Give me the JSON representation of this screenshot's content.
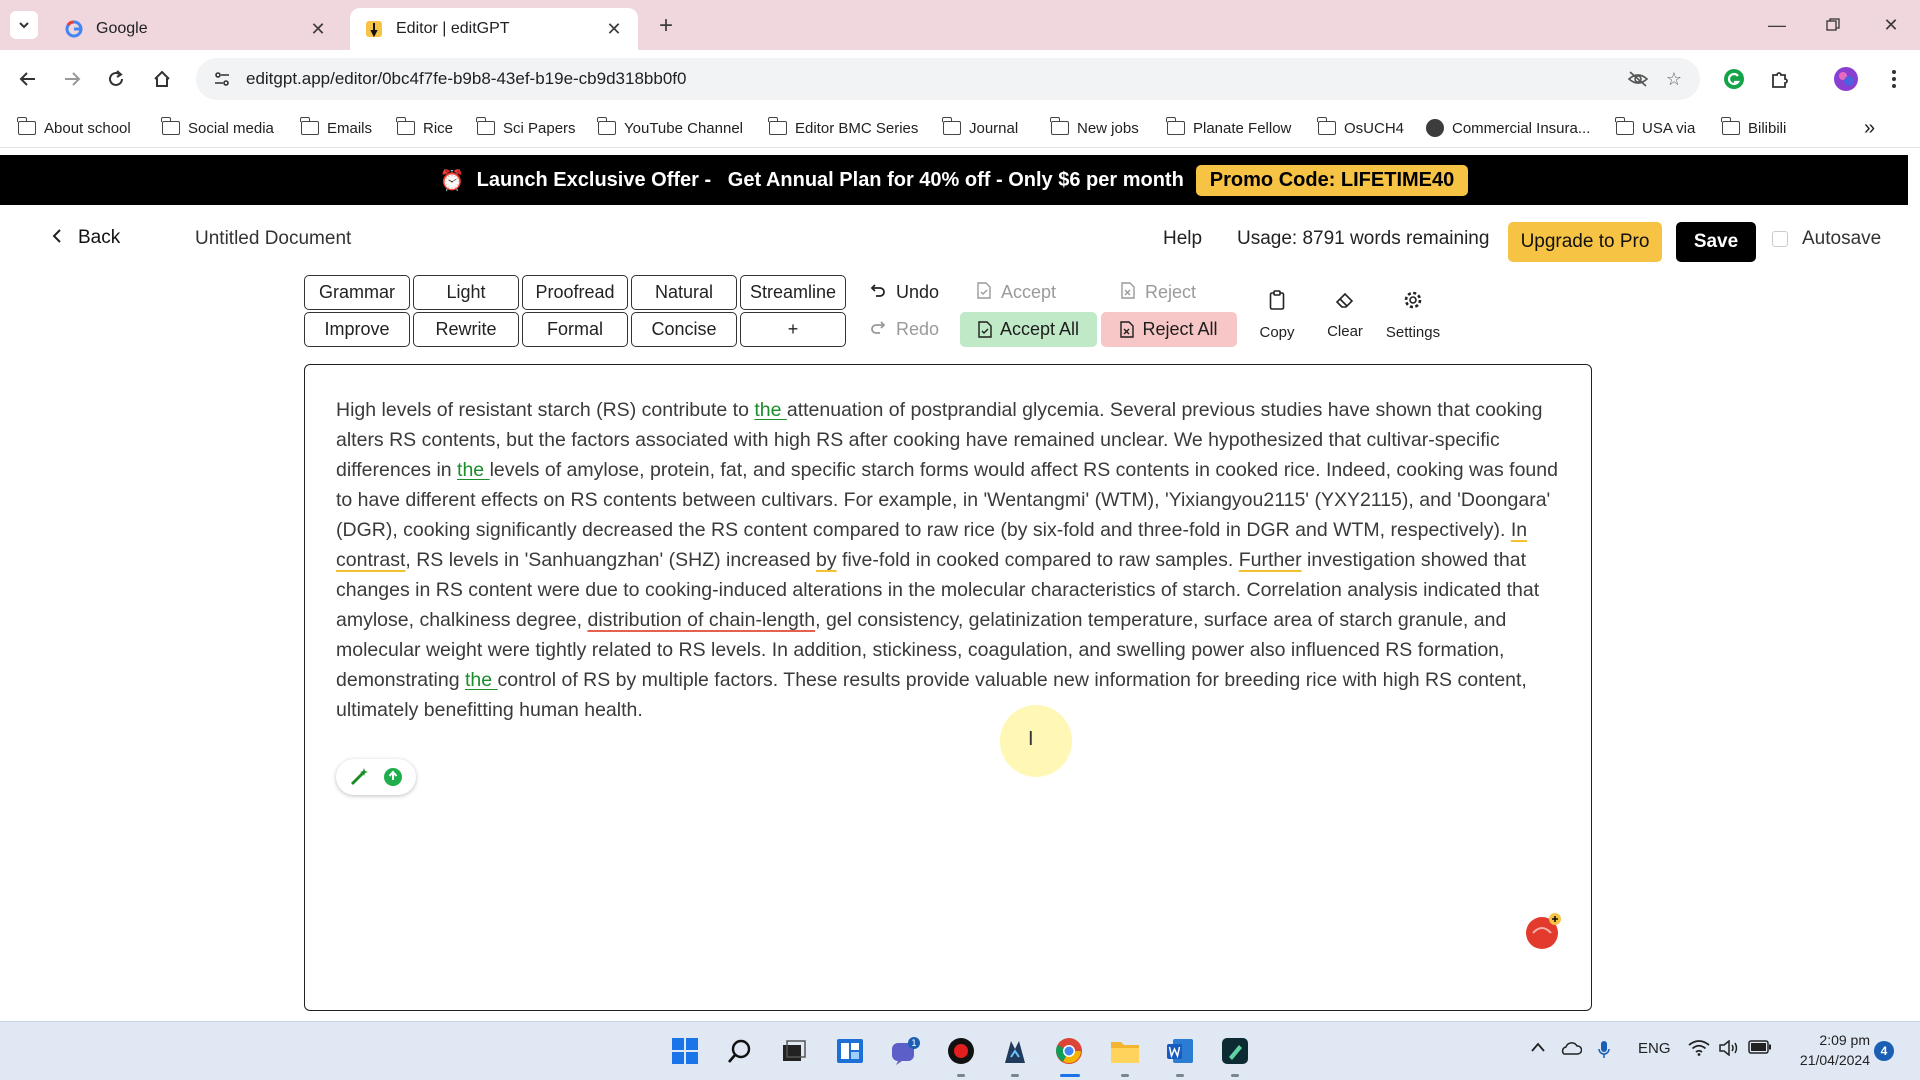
{
  "browser": {
    "tabs": [
      {
        "title": "Google",
        "favicon": "google-icon"
      },
      {
        "title": "Editor | editGPT",
        "favicon": "editgpt-icon"
      }
    ],
    "url": "editgpt.app/editor/0bc4f7fe-b9b8-43ef-b19e-cb9d318bb0f0",
    "bookmarks": [
      "About school",
      "Social media",
      "Emails",
      "Rice",
      "Sci Papers",
      "YouTube Channel",
      "Editor BMC Series",
      "Journal",
      "New jobs",
      "Planate Fellow",
      "OsUCH4",
      "Commercial Insura...",
      "USA via",
      "Bilibili"
    ],
    "more_bookmarks_glyph": "»"
  },
  "promo": {
    "text": "Launch Exclusive Offer -   Get Annual Plan for 40% off - Only $6 per month",
    "code": "Promo Code: LIFETIME40"
  },
  "header": {
    "back": "Back",
    "doc_title": "Untitled Document",
    "help": "Help",
    "usage": "Usage: 8791 words remaining",
    "upgrade": "Upgrade to Pro",
    "save": "Save",
    "autosave": "Autosave"
  },
  "modes": {
    "row1": [
      "Grammar",
      "Light",
      "Proofread",
      "Natural",
      "Streamline"
    ],
    "row2": [
      "Improve",
      "Rewrite",
      "Formal",
      "Concise",
      "+"
    ]
  },
  "actions": {
    "undo": "Undo",
    "redo": "Redo",
    "accept": "Accept",
    "reject": "Reject",
    "accept_all": "Accept All",
    "reject_all": "Reject All",
    "copy": "Copy",
    "clear": "Clear",
    "settings": "Settings"
  },
  "editor": {
    "segments": [
      {
        "text": "High levels of resistant starch (RS) contribute to ",
        "style": "plain"
      },
      {
        "text": "the ",
        "style": "ins"
      },
      {
        "text": "attenuation of postprandial glycemia. Several previous studies have shown that cooking alters RS contents, but the factors associated with high RS after cooking have remained unclear. We hypothesized that cultivar-specific differences in ",
        "style": "plain"
      },
      {
        "text": "the ",
        "style": "ins"
      },
      {
        "text": "levels of amylose, protein, fat, and specific starch forms would affect RS contents in cooked rice. Indeed, cooking was found to have different effects on RS contents between cultivars. For example, in 'Wentangmi' (WTM), 'Yixiangyou2115' (YXY2115), and 'Doongara' (DGR), cooking significantly decreased the RS content compared to raw rice (by six-fold and three-fold in DGR and WTM, respectively). ",
        "style": "plain"
      },
      {
        "text": "In contrast",
        "style": "sug"
      },
      {
        "text": ", RS levels in 'Sanhuangzhan' (SHZ) increased ",
        "style": "plain"
      },
      {
        "text": "by",
        "style": "sug"
      },
      {
        "text": " five-fold in cooked compared to raw samples. ",
        "style": "plain"
      },
      {
        "text": "Further",
        "style": "sug"
      },
      {
        "text": " investigation showed that changes in RS content were due to cooking-induced alterations in the molecular characteristics of starch. Correlation analysis indicated that amylose, chalkiness degree, ",
        "style": "plain"
      },
      {
        "text": "distribution of chain-length",
        "style": "sug-red"
      },
      {
        "text": ", gel consistency, gelatinization temperature, surface area of starch granule, and molecular weight were tightly related to RS levels. In addition, stickiness, coagulation, and swelling power also influenced RS formation, demonstrating ",
        "style": "plain"
      },
      {
        "text": "the ",
        "style": "ins"
      },
      {
        "text": "control of RS by multiple factors. These results provide valuable new information for breeding rice with high RS content, ultimately benefitting human health.",
        "style": "plain"
      }
    ]
  },
  "taskbar": {
    "language": "ENG",
    "time": "2:09 pm",
    "date": "21/04/2024",
    "notifications": "4",
    "teams_badge": "1"
  },
  "colors": {
    "promo_bg": "#000000",
    "accent_yellow": "#f6c344",
    "accept_green": "#bfe9c7",
    "reject_red": "#f7c6c6",
    "insert_green": "#1a8c2a",
    "tab_strip": "#f0d6dd"
  }
}
